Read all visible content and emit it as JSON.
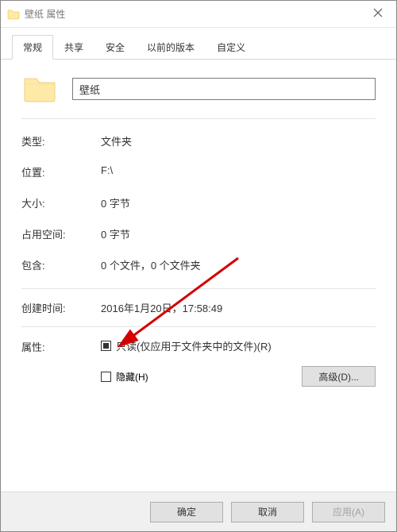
{
  "titlebar": {
    "title": "壁纸 属性"
  },
  "tabs": {
    "general": "常规",
    "sharing": "共享",
    "security": "安全",
    "previous": "以前的版本",
    "customize": "自定义"
  },
  "header": {
    "name": "壁纸"
  },
  "fields": {
    "type_label": "类型:",
    "type_value": "文件夹",
    "location_label": "位置:",
    "location_value": "F:\\",
    "size_label": "大小:",
    "size_value": "0 字节",
    "diskspace_label": "占用空间:",
    "diskspace_value": "0 字节",
    "contains_label": "包含:",
    "contains_value": "0 个文件，0 个文件夹",
    "created_label": "创建时间:",
    "created_value": "2016年1月20日，17:58:49"
  },
  "attributes": {
    "label": "属性:",
    "readonly": "只读(仅应用于文件夹中的文件)(R)",
    "hidden": "隐藏(H)",
    "advanced": "高级(D)..."
  },
  "footer": {
    "ok": "确定",
    "cancel": "取消",
    "apply": "应用(A)"
  }
}
